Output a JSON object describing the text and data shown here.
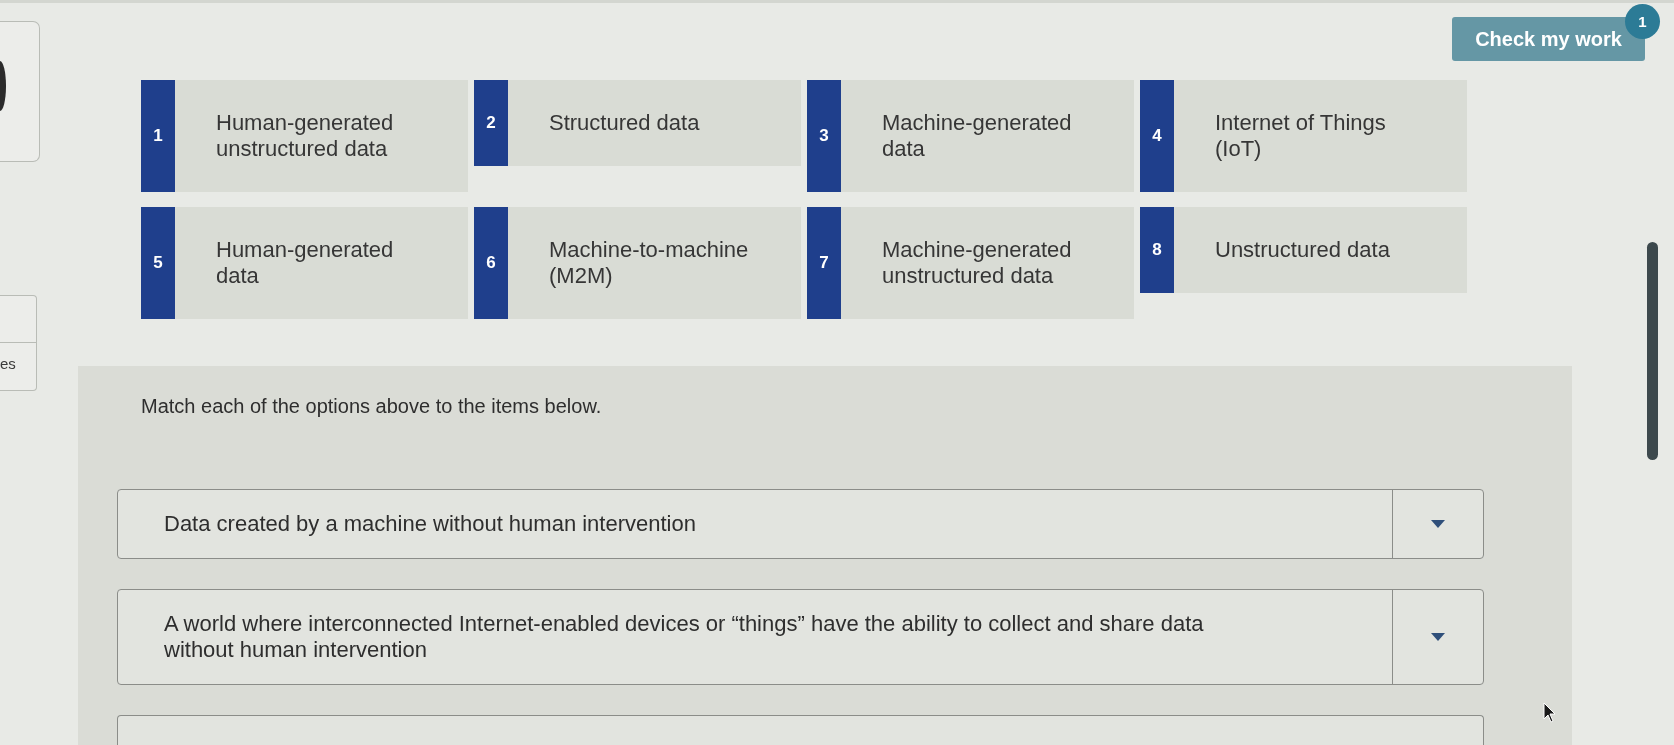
{
  "sidebar": {
    "label": "es"
  },
  "header": {
    "check_button": "Check my work",
    "badge": "1"
  },
  "options": [
    {
      "number": "1",
      "label": "Human-generated unstructured data"
    },
    {
      "number": "2",
      "label": "Structured data"
    },
    {
      "number": "3",
      "label": "Machine-generated data"
    },
    {
      "number": "4",
      "label": "Internet of Things (IoT)"
    },
    {
      "number": "5",
      "label": "Human-generated data"
    },
    {
      "number": "6",
      "label": "Machine-to-machine (M2M)"
    },
    {
      "number": "7",
      "label": "Machine-generated unstructured data"
    },
    {
      "number": "8",
      "label": "Unstructured data"
    }
  ],
  "question": {
    "instruction": "Match each of the options above to the items below.",
    "items": [
      {
        "text": "Data created by a machine without human intervention"
      },
      {
        "text": "A world where interconnected Internet-enabled devices or “things” have the ability to collect and share data without human intervention"
      }
    ]
  }
}
